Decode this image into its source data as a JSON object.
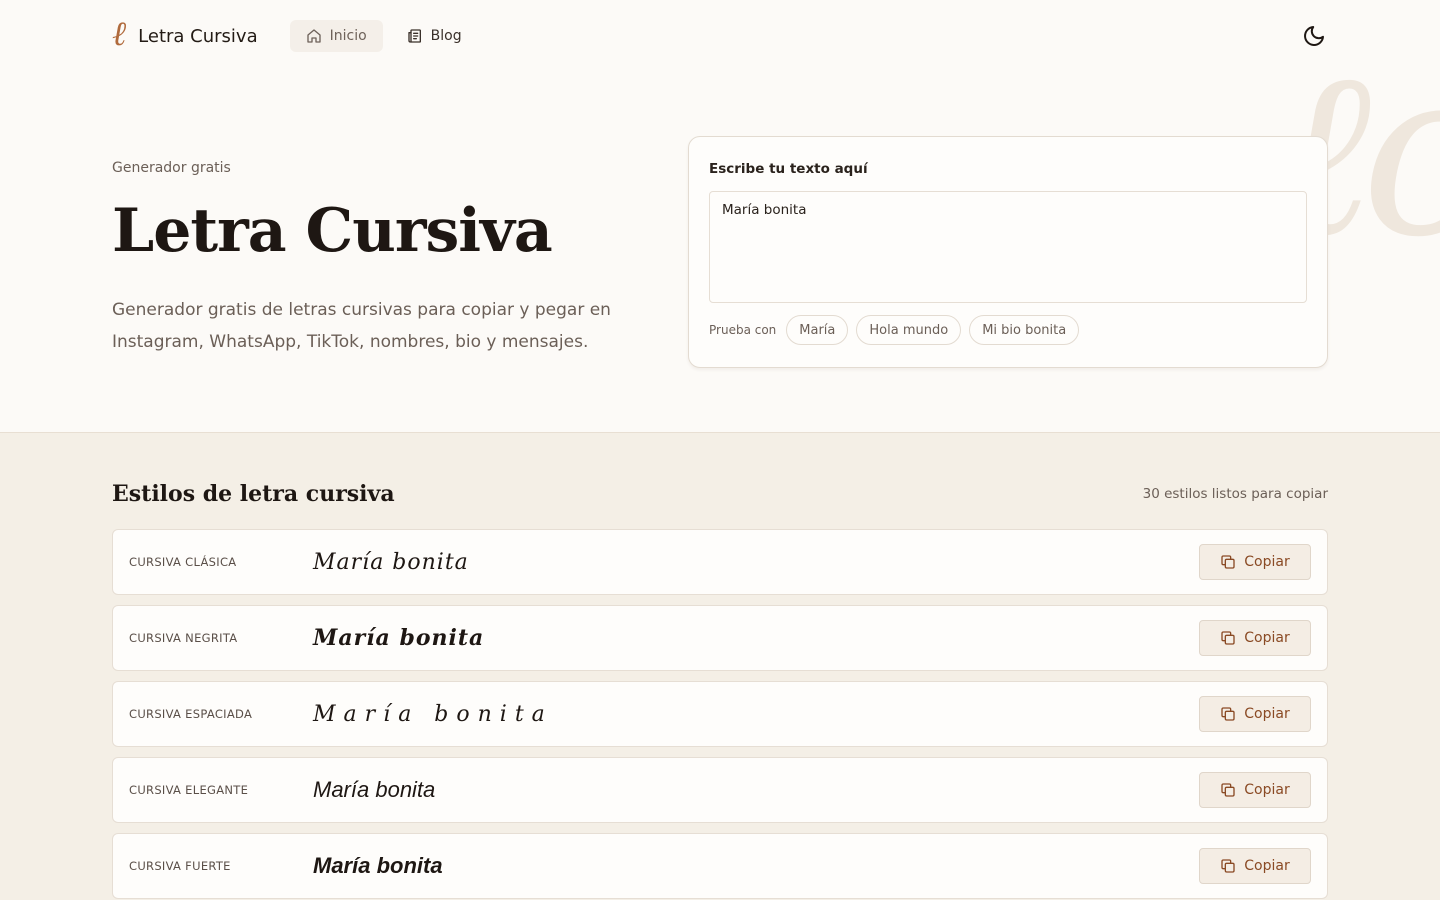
{
  "brand": {
    "logo_letter": "ℓ",
    "name": "Letra Cursiva",
    "accent_color": "#b06a3c"
  },
  "nav": {
    "items": [
      {
        "label": "Inicio",
        "icon": "home-icon",
        "active": true
      },
      {
        "label": "Blog",
        "icon": "document-icon",
        "active": false
      }
    ],
    "theme_icon": "moon-icon"
  },
  "hero": {
    "eyebrow": "Generador gratis",
    "title": "Letra Cursiva",
    "description": "Generador gratis de letras cursivas para copiar y pegar en Instagram, WhatsApp, TikTok, nombres, bio y mensajes."
  },
  "input_card": {
    "label": "Escribe tu texto aquí",
    "value": "María bonita",
    "try_label": "Prueba con",
    "chips": [
      "María",
      "Hola mundo",
      "Mi bio bonita"
    ]
  },
  "styles_section": {
    "title": "Estilos de letra cursiva",
    "count_text": "30 estilos listos para copiar",
    "copy_label": "Copiar",
    "rows": [
      {
        "name": "CURSIVA CLÁSICA",
        "sample": "María bonita"
      },
      {
        "name": "CURSIVA NEGRITA",
        "sample": "María bonita"
      },
      {
        "name": "CURSIVA ESPACIADA",
        "sample": "María bonita"
      },
      {
        "name": "CURSIVA ELEGANTE",
        "sample": "María bonita"
      },
      {
        "name": "CURSIVA FUERTE",
        "sample": "María bonita"
      }
    ]
  }
}
